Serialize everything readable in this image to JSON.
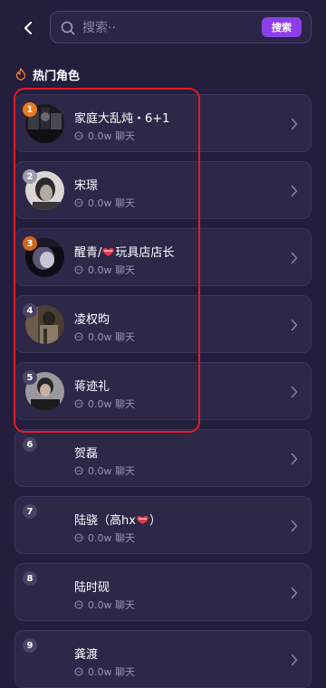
{
  "header": {
    "back_icon": "chevron-left-icon",
    "search_placeholder": "搜索··",
    "search_button": "搜索"
  },
  "section": {
    "icon": "fire-icon",
    "title": "热门角色"
  },
  "colors": {
    "rank_1": "#f07a1a",
    "rank_2": "#9d9aad",
    "rank_3": "#d0651e",
    "rank_default": "#4a4366",
    "highlight": "#e01c28",
    "search_button_bg": "#8b3fe8"
  },
  "characters": [
    {
      "rank": "1",
      "name": "家庭大乱炖・6+1",
      "chat": "0.0w 聊天"
    },
    {
      "rank": "2",
      "name": "宋璟",
      "chat": "0.0w 聊天"
    },
    {
      "rank": "3",
      "name_before": "醒青/",
      "name_after": "玩具店店长",
      "chat": "0.0w 聊天"
    },
    {
      "rank": "4",
      "name": "凌权昀",
      "chat": "0.0w 聊天"
    },
    {
      "rank": "5",
      "name": "蒋迹礼",
      "chat": "0.0w 聊天"
    },
    {
      "rank": "6",
      "name": "贺磊",
      "chat": "0.0w 聊天"
    },
    {
      "rank": "7",
      "name_before": "陆骁（高hx",
      "name_after": "）",
      "chat": "0.0w 聊天"
    },
    {
      "rank": "8",
      "name": "陆时砚",
      "chat": "0.0w 聊天"
    },
    {
      "rank": "9",
      "name": "龚渡",
      "chat": "0.0w 聊天"
    }
  ]
}
